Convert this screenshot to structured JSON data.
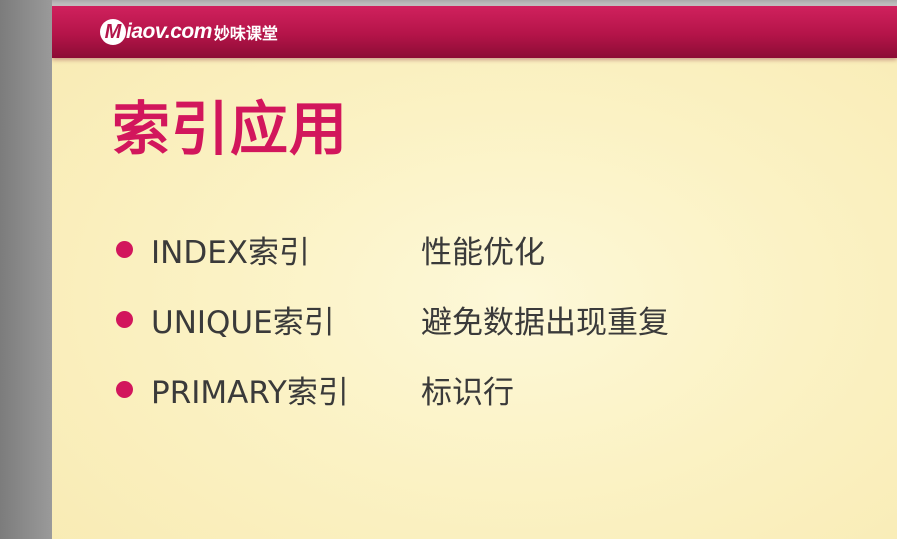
{
  "header": {
    "logo_letter": "M",
    "logo_text": "iaov.com",
    "logo_cn": "妙味课堂"
  },
  "slide": {
    "title": "索引应用",
    "bullets": [
      {
        "term": "INDEX索引",
        "desc": "性能优化"
      },
      {
        "term": "UNIQUE索引",
        "desc": "避免数据出现重复"
      },
      {
        "term": "PRIMARY索引",
        "desc": "标识行"
      }
    ]
  },
  "colors": {
    "accent": "#d2165c",
    "header": "#b41449",
    "background": "#fbf2c4",
    "text": "#3a3a3a"
  }
}
